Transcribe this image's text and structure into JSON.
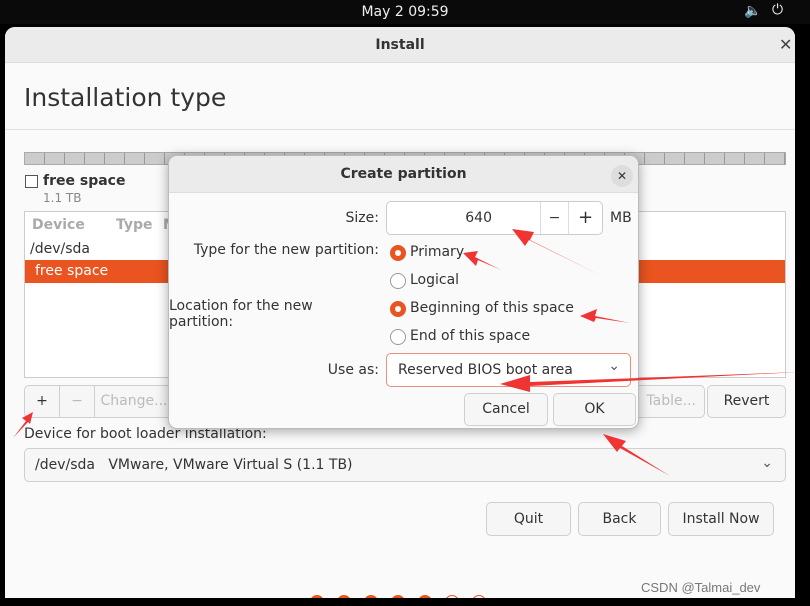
{
  "topbar": {
    "clock": "May 2  09:59",
    "icons": [
      "volume-icon",
      "power-icon"
    ]
  },
  "window": {
    "title": "Install",
    "heading": "Installation type"
  },
  "disk": {
    "label": "free space",
    "size": "1.1 TB"
  },
  "table": {
    "columns": [
      "Device",
      "Type",
      "M"
    ],
    "rows": [
      {
        "device": "/dev/sda"
      },
      {
        "device": "free space",
        "selected": true
      }
    ]
  },
  "toolbar": {
    "add": "+",
    "remove": "−",
    "change": "Change...",
    "new_table": "Table...",
    "revert": "Revert"
  },
  "bootloader": {
    "label": "Device for boot loader installation:",
    "device": "/dev/sda",
    "description": "VMware, VMware Virtual S (1.1 TB)"
  },
  "footer": {
    "quit": "Quit",
    "back": "Back",
    "install": "Install Now"
  },
  "progress": {
    "total": 7,
    "done": 5
  },
  "dialog": {
    "title": "Create partition",
    "size_label": "Size:",
    "size_value": "640",
    "size_unit": "MB",
    "type_label": "Type for the new partition:",
    "type_options": [
      {
        "label": "Primary",
        "selected": true
      },
      {
        "label": "Logical",
        "selected": false
      }
    ],
    "location_label": "Location for the new partition:",
    "location_options": [
      {
        "label": "Beginning of this space",
        "selected": true
      },
      {
        "label": "End of this space",
        "selected": false
      }
    ],
    "useas_label": "Use as:",
    "useas_value": "Reserved BIOS boot area",
    "cancel": "Cancel",
    "ok": "OK"
  },
  "watermark": "CSDN @Talmai_dev",
  "colors": {
    "accent": "#e95420",
    "arrow": "#f03434"
  }
}
